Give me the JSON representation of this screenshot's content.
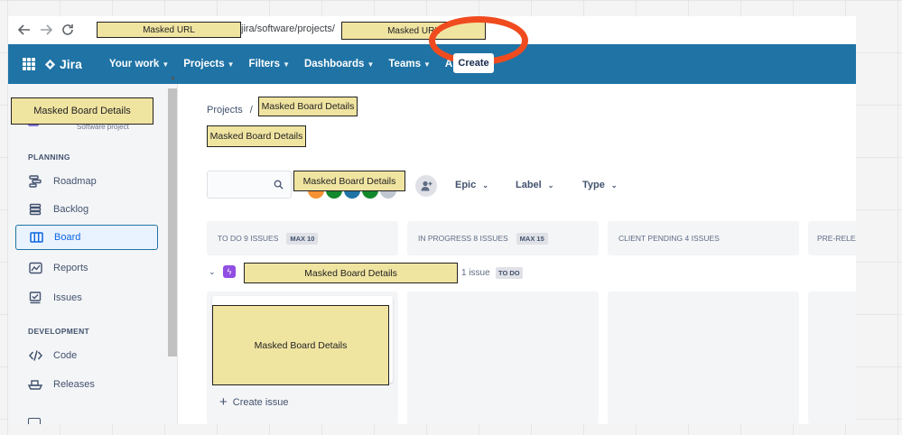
{
  "browser": {
    "url_mask_left": "Masked URL",
    "url_middle": "jira/software/projects/",
    "url_mask_right": "Masked URL"
  },
  "topnav": {
    "logo": "Jira",
    "items": [
      "Your work",
      "Projects",
      "Filters",
      "Dashboards",
      "Teams",
      "Apps"
    ],
    "create_label": "Create"
  },
  "sidebar": {
    "project_mask": "Masked Board Details",
    "project_type": "Software project",
    "sections": {
      "planning": "PLANNING",
      "development": "DEVELOPMENT"
    },
    "planning_items": [
      "Roadmap",
      "Backlog",
      "Board",
      "Reports",
      "Issues"
    ],
    "development_items": [
      "Code",
      "Releases"
    ],
    "active_item": "Board"
  },
  "main": {
    "breadcrumb_projects": "Projects",
    "breadcrumb_sep": "/",
    "breadcrumb_mask": "Masked Board Details",
    "title_mask": "Masked Board Details",
    "avatars_mask": "Masked Board Details",
    "filters": [
      "Epic",
      "Label",
      "Type"
    ],
    "columns": [
      {
        "label": "TO DO 9 ISSUES",
        "max": "MAX 10"
      },
      {
        "label": "IN PROGRESS 8 ISSUES",
        "max": "MAX 15"
      },
      {
        "label": "CLIENT PENDING 4 ISSUES",
        "max": ""
      },
      {
        "label": "PRE-RELEA",
        "max": ""
      }
    ],
    "swimlane": {
      "mask": "Masked Board Details",
      "count": "1 issue",
      "status": "TO DO"
    },
    "card_mask": "Masked Board Details",
    "create_issue": "Create issue"
  },
  "colors": {
    "topnav": "#1f73a5",
    "annotation_ring": "#f04b1f",
    "mask_fill": "#f0e4a1",
    "epic": "#904ee2"
  }
}
